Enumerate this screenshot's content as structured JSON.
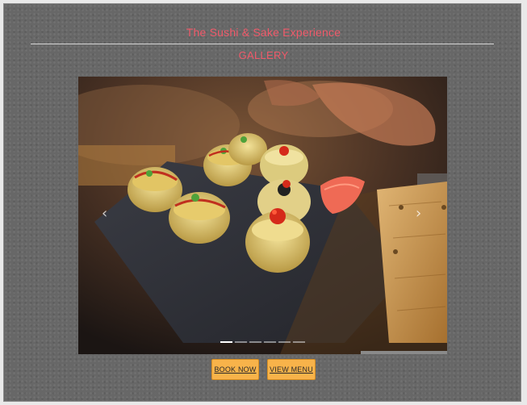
{
  "header": {
    "site_title": "The Sushi & Sake Experience",
    "section_heading": "GALLERY"
  },
  "gallery": {
    "prev_icon": "chevron-left-icon",
    "next_icon": "chevron-right-icon",
    "prev_glyph": "‹",
    "next_glyph": "›",
    "slide_count": 6,
    "active_slide": 1,
    "image_subject": "sushi rolls on slate plate"
  },
  "actions": {
    "book_now_label": "BOOK NOW",
    "view_menu_label": "VIEW MENU"
  },
  "colors": {
    "accent": "#f05a6a",
    "button": "#f8b34a",
    "background": "#676767"
  }
}
